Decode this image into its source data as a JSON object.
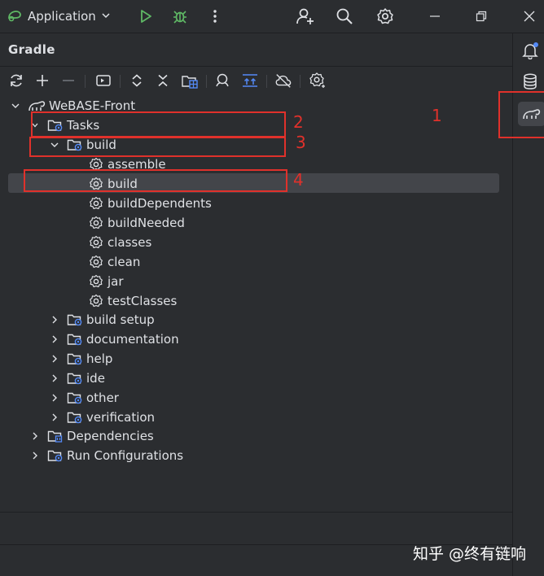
{
  "titlebar": {
    "run_config": "Application",
    "icons": [
      "app-icon",
      "chevron-down-icon",
      "run-icon",
      "debug-icon",
      "more-vert-icon",
      "add-user-icon",
      "search-icon",
      "gear-icon",
      "minimize-icon",
      "restore-icon",
      "close-icon"
    ]
  },
  "panel": {
    "title": "Gradle"
  },
  "toolbar": {
    "icons": [
      "refresh-icon",
      "plus-icon",
      "minus-icon",
      "run-task-icon",
      "expand-all-icon",
      "collapse-all-icon",
      "analyze-dependencies-icon",
      "toggle-offline-icon",
      "show-tasks-icon",
      "offline-cloud-icon",
      "settings-icon"
    ]
  },
  "tree": {
    "root": "WeBASE-Front",
    "tasks": "Tasks",
    "build_group": "build",
    "build_tasks": [
      "assemble",
      "build",
      "buildDependents",
      "buildNeeded",
      "classes",
      "clean",
      "jar",
      "testClasses"
    ],
    "other_groups": [
      "build setup",
      "documentation",
      "help",
      "ide",
      "other",
      "verification"
    ],
    "dependencies": "Dependencies",
    "run_configurations": "Run Configurations"
  },
  "annotations": {
    "n1": "1",
    "n2": "2",
    "n3": "3",
    "n4": "4"
  },
  "colors": {
    "accent_green": "#5fb865",
    "annotation_red": "#e0312b",
    "folder_blue": "#548af7",
    "background": "#2b2d30"
  },
  "watermark": "知乎 @终有链响"
}
